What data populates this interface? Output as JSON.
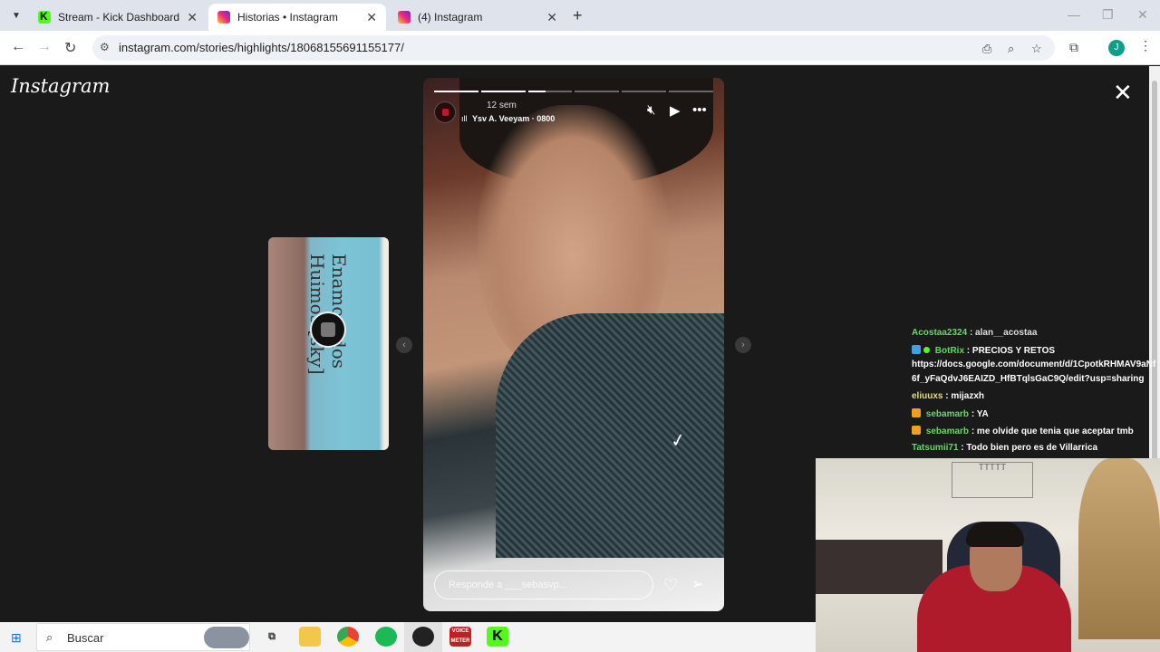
{
  "browser": {
    "tabs": [
      {
        "title": "Stream - Kick Dashboard",
        "favicon": "kick-icon",
        "active": false
      },
      {
        "title": "Historias • Instagram",
        "favicon": "instagram-icon",
        "active": true
      },
      {
        "title": "(4) Instagram",
        "favicon": "instagram-icon",
        "active": false
      }
    ],
    "new_tab_glyph": "+",
    "close_glyph": "✕",
    "url": "instagram.com/stories/highlights/18068155691155177/",
    "profile_initial": "J"
  },
  "instagram": {
    "logo": "Instagram",
    "prev_story_text": "Enamorados Huimos [sky]",
    "story": {
      "time_ago": "12 sem",
      "audio": "Ysv A. Veeyam · 0800",
      "reply_placeholder": "Responde a ___sebasvp...",
      "segments": [
        "done",
        "done",
        "partial",
        "empty",
        "empty",
        "empty"
      ]
    }
  },
  "chat": [
    {
      "user": "Acostaa2324",
      "text": ": alan__acostaa",
      "badge": "",
      "color": "green"
    },
    {
      "user": "BotRix",
      "text": ": PRECIOS Y RETOS",
      "badge": "bot",
      "color": "green"
    },
    {
      "user": "",
      "text": "https://docs.google.com/document/d/1CpotkRHMAV9aNf",
      "badge": "",
      "color": "white"
    },
    {
      "user": "",
      "text": "6f_yFaQdvJ6EAIZD_HfBTqlsGaC9Q/edit?usp=sharing",
      "badge": "",
      "color": "white"
    },
    {
      "user": "eliuuxs",
      "text": ": mijazxh",
      "badge": "",
      "color": "yellow"
    },
    {
      "user": "sebamarb",
      "text": ": YA",
      "badge": "gift",
      "color": "green"
    },
    {
      "user": "sebamarb",
      "text": ": me olvide que tenia que aceptar tmb",
      "badge": "gift",
      "color": "green"
    },
    {
      "user": "Tatsumii71",
      "text": ": Todo bien pero es de Villarrica",
      "badge": "",
      "color": "green"
    }
  ],
  "webcam": {
    "wall_drawing": "TTTTT"
  },
  "taskbar": {
    "search_label": "Buscar",
    "apps": [
      "task-view-icon",
      "file-explorer-icon",
      "chrome-icon",
      "spotify-icon",
      "obs-icon",
      "voicemeeter-icon",
      "kick-icon"
    ],
    "voicemeeter_label": "VOICE METER"
  },
  "colors": {
    "kick_green": "#53fc18",
    "chat_user_green": "#6ad66a",
    "chat_user_yellow": "#e8dc7a"
  }
}
